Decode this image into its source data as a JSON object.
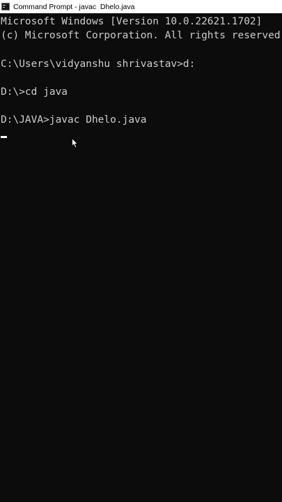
{
  "window": {
    "title": "Command Prompt - javac  Dhelo.java",
    "icon": "cmd-console-icon"
  },
  "console": {
    "lines": [
      "Microsoft Windows [Version 10.0.22621.1702]",
      "(c) Microsoft Corporation. All rights reserved.",
      "",
      "C:\\Users\\vidyanshu shrivastav>d:",
      "",
      "D:\\>cd java",
      "",
      "D:\\JAVA>javac Dhelo.java"
    ]
  },
  "colors": {
    "console_background": "#0c0c0c",
    "console_text": "#cccccc",
    "titlebar_background": "#ffffff",
    "cursor": "#ffffff"
  }
}
